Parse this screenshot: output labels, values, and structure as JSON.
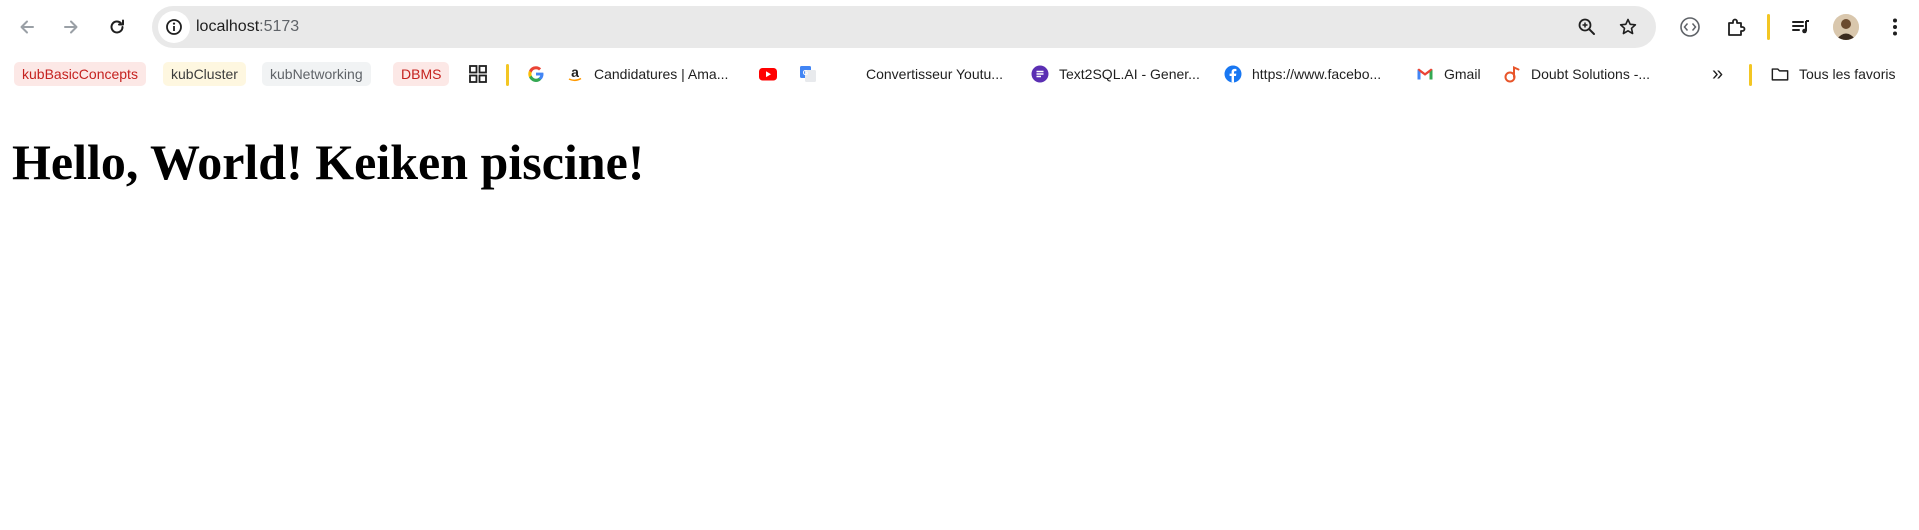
{
  "browser": {
    "address_bar": {
      "host": "localhost",
      "port": ":5173"
    }
  },
  "bookmarks": {
    "tags": [
      {
        "label": "kubBasicConcepts",
        "bg": "#fce8e6",
        "fg": "#c5221f"
      },
      {
        "label": "kubCluster",
        "bg": "#fef7e0",
        "fg": "#3c3c3c"
      },
      {
        "label": "kubNetworking",
        "bg": "#f1f3f4",
        "fg": "#5f6368"
      },
      {
        "label": "DBMS",
        "bg": "#fce8e6",
        "fg": "#c5221f"
      }
    ],
    "items": [
      {
        "label": "Candidatures | Ama...",
        "icon": "amazon-icon"
      },
      {
        "label": "Convertisseur Youtu...",
        "icon": "none"
      },
      {
        "label": "Text2SQL.AI - Gener...",
        "icon": "text2sql-icon"
      },
      {
        "label": "https://www.facebo...",
        "icon": "facebook-icon"
      },
      {
        "label": "Gmail",
        "icon": "gmail-icon"
      },
      {
        "label": "Doubt Solutions -...",
        "icon": "doubt-solutions-icon"
      }
    ],
    "all_bookmarks_label": "Tous les favoris",
    "more_glyph": "»"
  },
  "page": {
    "heading": "Hello, World! Keiken piscine!"
  },
  "colors": {
    "omnibox_bg": "#e9e9e9",
    "separator": "#f3c623",
    "youtube": "#ff0000",
    "facebook": "#1877f2",
    "text2sql": "#5b2fb3"
  }
}
